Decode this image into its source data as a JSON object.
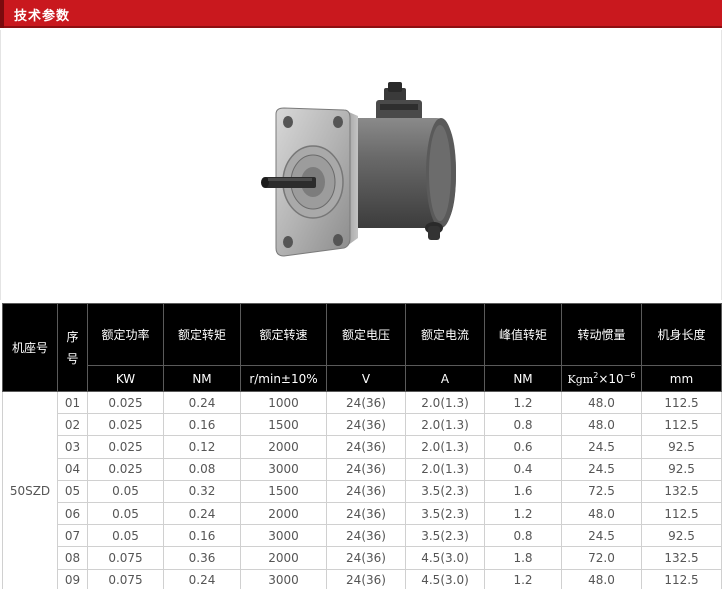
{
  "section_title": "技术参数",
  "image": {
    "name": "servo-motor"
  },
  "table": {
    "headers": {
      "model": "机座号",
      "index": "序号",
      "power": "额定功率",
      "torque": "额定转矩",
      "speed": "额定转速",
      "voltage": "额定电压",
      "current": "额定电流",
      "peak_torque": "峰值转矩",
      "inertia": "转动惯量",
      "length": "机身长度"
    },
    "units": {
      "power": "KW",
      "torque": "NM",
      "speed": "r/min±10%",
      "voltage": "V",
      "current": "A",
      "peak_torque": "NM",
      "inertia_base": "Kgm",
      "inertia_exp1": "2",
      "inertia_times": "×10",
      "inertia_exp2": "−6",
      "length": "mm"
    },
    "model": "50SZD",
    "rows": [
      {
        "no": "01",
        "power": "0.025",
        "torque": "0.24",
        "speed": "1000",
        "voltage": "24(36)",
        "current": "2.0(1.3)",
        "peak": "1.2",
        "inertia": "48.0",
        "length": "112.5"
      },
      {
        "no": "02",
        "power": "0.025",
        "torque": "0.16",
        "speed": "1500",
        "voltage": "24(36)",
        "current": "2.0(1.3)",
        "peak": "0.8",
        "inertia": "48.0",
        "length": "112.5"
      },
      {
        "no": "03",
        "power": "0.025",
        "torque": "0.12",
        "speed": "2000",
        "voltage": "24(36)",
        "current": "2.0(1.3)",
        "peak": "0.6",
        "inertia": "24.5",
        "length": "92.5"
      },
      {
        "no": "04",
        "power": "0.025",
        "torque": "0.08",
        "speed": "3000",
        "voltage": "24(36)",
        "current": "2.0(1.3)",
        "peak": "0.4",
        "inertia": "24.5",
        "length": "92.5"
      },
      {
        "no": "05",
        "power": "0.05",
        "torque": "0.32",
        "speed": "1500",
        "voltage": "24(36)",
        "current": "3.5(2.3)",
        "peak": "1.6",
        "inertia": "72.5",
        "length": "132.5"
      },
      {
        "no": "06",
        "power": "0.05",
        "torque": "0.24",
        "speed": "2000",
        "voltage": "24(36)",
        "current": "3.5(2.3)",
        "peak": "1.2",
        "inertia": "48.0",
        "length": "112.5"
      },
      {
        "no": "07",
        "power": "0.05",
        "torque": "0.16",
        "speed": "3000",
        "voltage": "24(36)",
        "current": "3.5(2.3)",
        "peak": "0.8",
        "inertia": "24.5",
        "length": "92.5"
      },
      {
        "no": "08",
        "power": "0.075",
        "torque": "0.36",
        "speed": "2000",
        "voltage": "24(36)",
        "current": "4.5(3.0)",
        "peak": "1.8",
        "inertia": "72.0",
        "length": "132.5"
      },
      {
        "no": "09",
        "power": "0.075",
        "torque": "0.24",
        "speed": "3000",
        "voltage": "24(36)",
        "current": "4.5(3.0)",
        "peak": "1.2",
        "inertia": "48.0",
        "length": "112.5"
      }
    ]
  }
}
